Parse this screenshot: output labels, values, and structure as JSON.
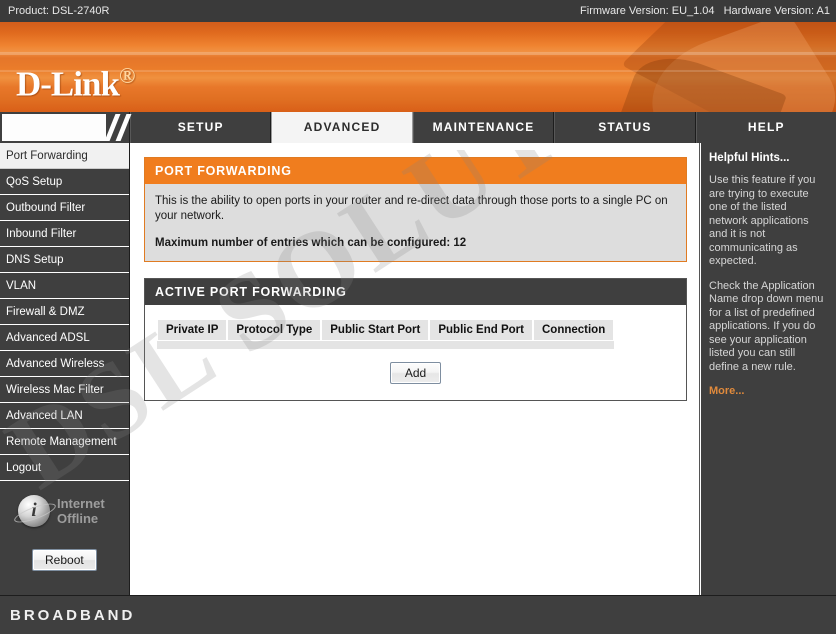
{
  "product_bar": {
    "product_label": "Product: DSL-2740R",
    "firmware_label": "Firmware Version: EU_1.04",
    "hardware_label": "Hardware Version: A1"
  },
  "banner": {
    "brand": "D-Link",
    "brand_dot": "®"
  },
  "nav": {
    "tabs": [
      {
        "label": "SETUP",
        "active": false
      },
      {
        "label": "ADVANCED",
        "active": true
      },
      {
        "label": "MAINTENANCE",
        "active": false
      },
      {
        "label": "STATUS",
        "active": false
      },
      {
        "label": "HELP",
        "active": false
      }
    ]
  },
  "sidebar": {
    "items": [
      {
        "label": "Port Forwarding",
        "active": true
      },
      {
        "label": "QoS Setup",
        "active": false
      },
      {
        "label": "Outbound Filter",
        "active": false
      },
      {
        "label": "Inbound Filter",
        "active": false
      },
      {
        "label": "DNS Setup",
        "active": false
      },
      {
        "label": "VLAN",
        "active": false
      },
      {
        "label": "Firewall & DMZ",
        "active": false
      },
      {
        "label": "Advanced ADSL",
        "active": false
      },
      {
        "label": "Advanced Wireless",
        "active": false
      },
      {
        "label": "Wireless Mac Filter",
        "active": false
      },
      {
        "label": "Advanced LAN",
        "active": false
      },
      {
        "label": "Remote Management",
        "active": false
      },
      {
        "label": "Logout",
        "active": false
      }
    ],
    "status": {
      "line1": "Internet",
      "line2": "Offline",
      "icon": "info-globe-icon"
    },
    "reboot_label": "Reboot"
  },
  "main": {
    "info_panel": {
      "title": "PORT FORWARDING",
      "description": "This is the ability to open ports in your router and re-direct data through those ports to a single PC on your network.",
      "max_entries_text": "Maximum number of entries which can be configured: 12"
    },
    "active_panel": {
      "title": "ACTIVE PORT FORWARDING",
      "columns": [
        "Private IP",
        "Protocol Type",
        "Public Start Port",
        "Public End Port",
        "Connection"
      ],
      "rows": [],
      "add_label": "Add"
    }
  },
  "hints": {
    "title": "Helpful Hints...",
    "paragraphs": [
      "Use this feature if you are trying to execute one of the listed network applications and it is not communicating as expected.",
      "Check the Application Name drop down menu for a list of predefined applications. If you do see your application listed you can still define a new rule."
    ],
    "more_label": "More..."
  },
  "footer": {
    "text": "BROADBAND"
  },
  "watermark": {
    "text": "DSL SOLUTION"
  },
  "colors": {
    "accent_orange": "#f07d1e",
    "dark_panel": "#3f3f3f",
    "product_bar": "#3a3a3a",
    "hint_more": "#e08a3c",
    "table_header": "#e4e4e4"
  }
}
